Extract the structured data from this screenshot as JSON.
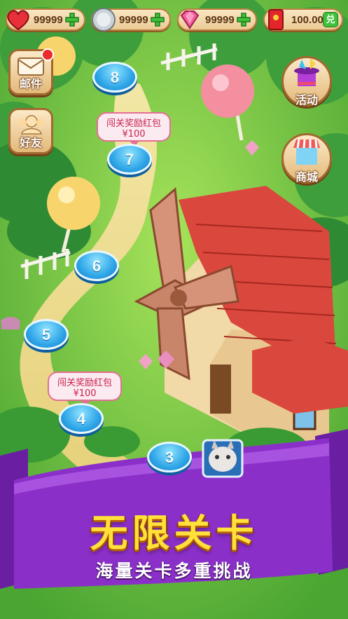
{
  "currency": {
    "hearts": "99999",
    "coins": "99999",
    "gems": "99999",
    "cash": "100.00",
    "cash_button": "兑"
  },
  "side_buttons": {
    "mail": "邮件",
    "friends": "好友",
    "events": "活动",
    "shop": "商城"
  },
  "levels": [
    "8",
    "7",
    "6",
    "5",
    "4",
    "3"
  ],
  "rewards": {
    "level7": {
      "title": "闯关奖励红包",
      "amount": "¥100"
    },
    "level4": {
      "title": "闯关奖励红包",
      "amount": "¥100"
    }
  },
  "banner": {
    "title": "无限关卡",
    "subtitle": "海量关卡多重挑战"
  },
  "colors": {
    "banner_purple": "#8b2fc9",
    "title_yellow": "#ffe13a",
    "level_blue": "#2fa6e8"
  }
}
